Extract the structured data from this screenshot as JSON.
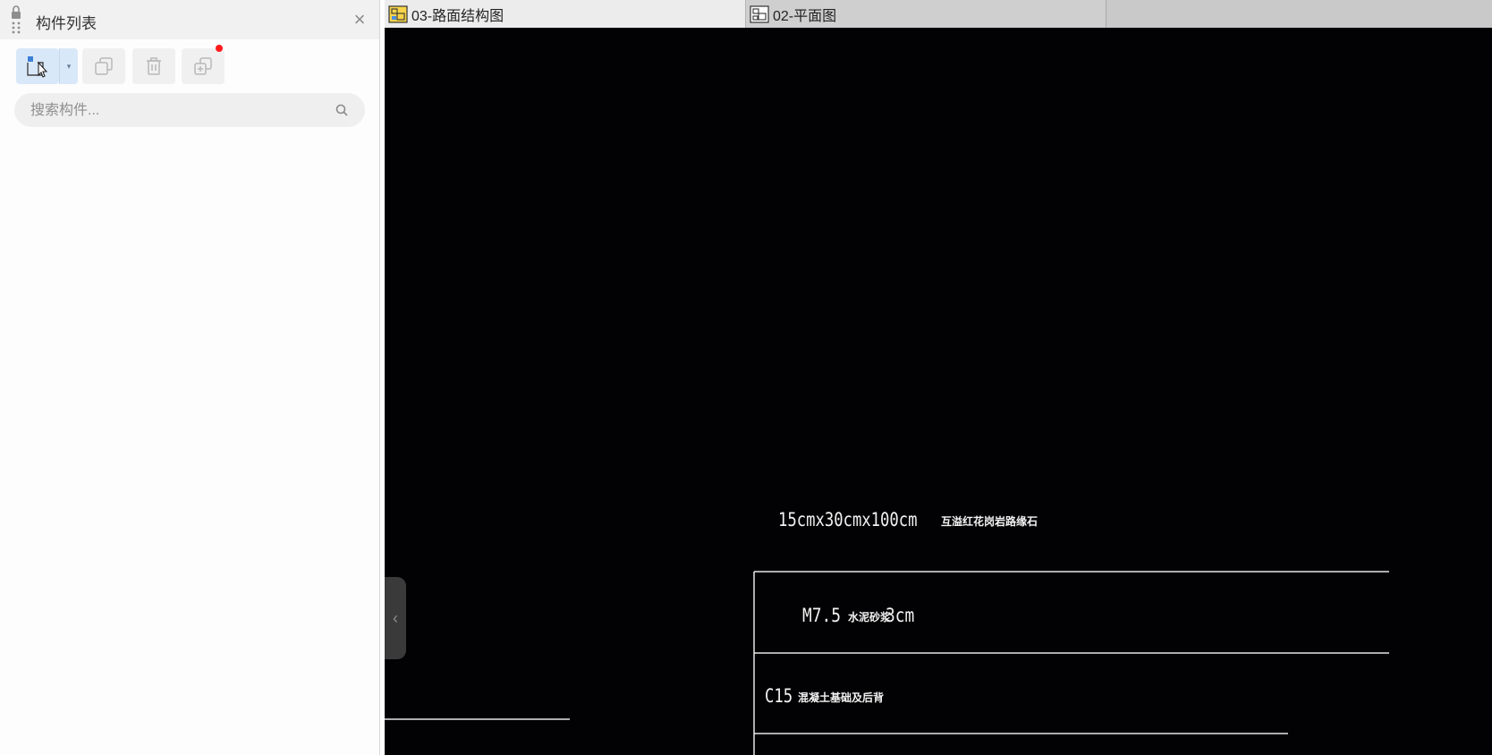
{
  "panel": {
    "title": "构件列表",
    "close_symbol": "×",
    "toolbar": {
      "new_icon": "new-component-icon",
      "dropdown_symbol": "▾",
      "copy_icon": "copy-icon",
      "delete_icon": "trash-icon",
      "layer_copy_icon": "layer-copy-icon",
      "notification_color": "#ff1a1a"
    },
    "search": {
      "placeholder": "搜索构件...",
      "value": ""
    }
  },
  "tabs": [
    {
      "label": "03-路面结构图",
      "icon": "drawing-icon",
      "active": true
    },
    {
      "label": "02-平面图",
      "icon": "drawing-icon",
      "active": false
    }
  ],
  "drawing": {
    "background": "#020204",
    "dimension_label": "15cmx30cmx100cm",
    "stone_label": "互溢红花岗岩路缘石",
    "layer1_grade": "M7.5",
    "layer1_material": "水泥砂浆",
    "layer1_thickness": "3cm",
    "layer2_grade": "C15",
    "layer2_material": "混凝土基础及后背",
    "collapse_symbol": "‹"
  }
}
